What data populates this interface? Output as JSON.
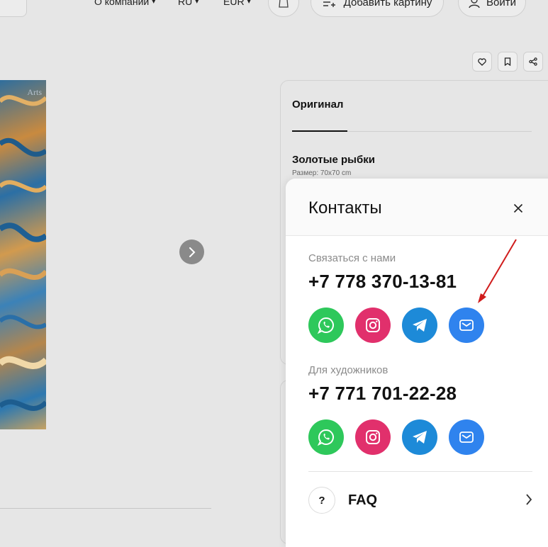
{
  "header": {
    "nav": [
      {
        "label": "О компании",
        "caret": "▾"
      },
      {
        "label": "RU",
        "caret": "▾"
      },
      {
        "label": "EUR",
        "caret": "▾"
      }
    ],
    "add_painting_label": "Добавить картину",
    "login_label": "Войти",
    "icons": [
      "cart-icon",
      "add-list-icon",
      "user-icon"
    ]
  },
  "gallery": {
    "watermark": "Arts",
    "icons": [
      "chevron-right-icon"
    ]
  },
  "product": {
    "tab_label": "Оригинал",
    "title": "Золотые рыбки",
    "size": "Размер: 70x70 cm",
    "action_icons": [
      "heart-icon",
      "bookmark-icon",
      "share-icon"
    ]
  },
  "modal": {
    "title": "Контакты",
    "sections": [
      {
        "label": "Связаться с нами",
        "phone": "+7 778 370-13-81"
      },
      {
        "label": "Для художников",
        "phone": "+7 771 701-22-28"
      }
    ],
    "social_icons": [
      "whatsapp-icon",
      "instagram-icon",
      "telegram-icon",
      "email-icon"
    ],
    "faq_label": "FAQ",
    "faq_mark": "?"
  },
  "colors": {
    "background": "#e6e6e6",
    "whatsapp": "#2ec85b",
    "instagram": "#e1306c",
    "telegram": "#1d8ad8",
    "email": "#2f83ee",
    "annotation_arrow": "#d01c1c"
  }
}
